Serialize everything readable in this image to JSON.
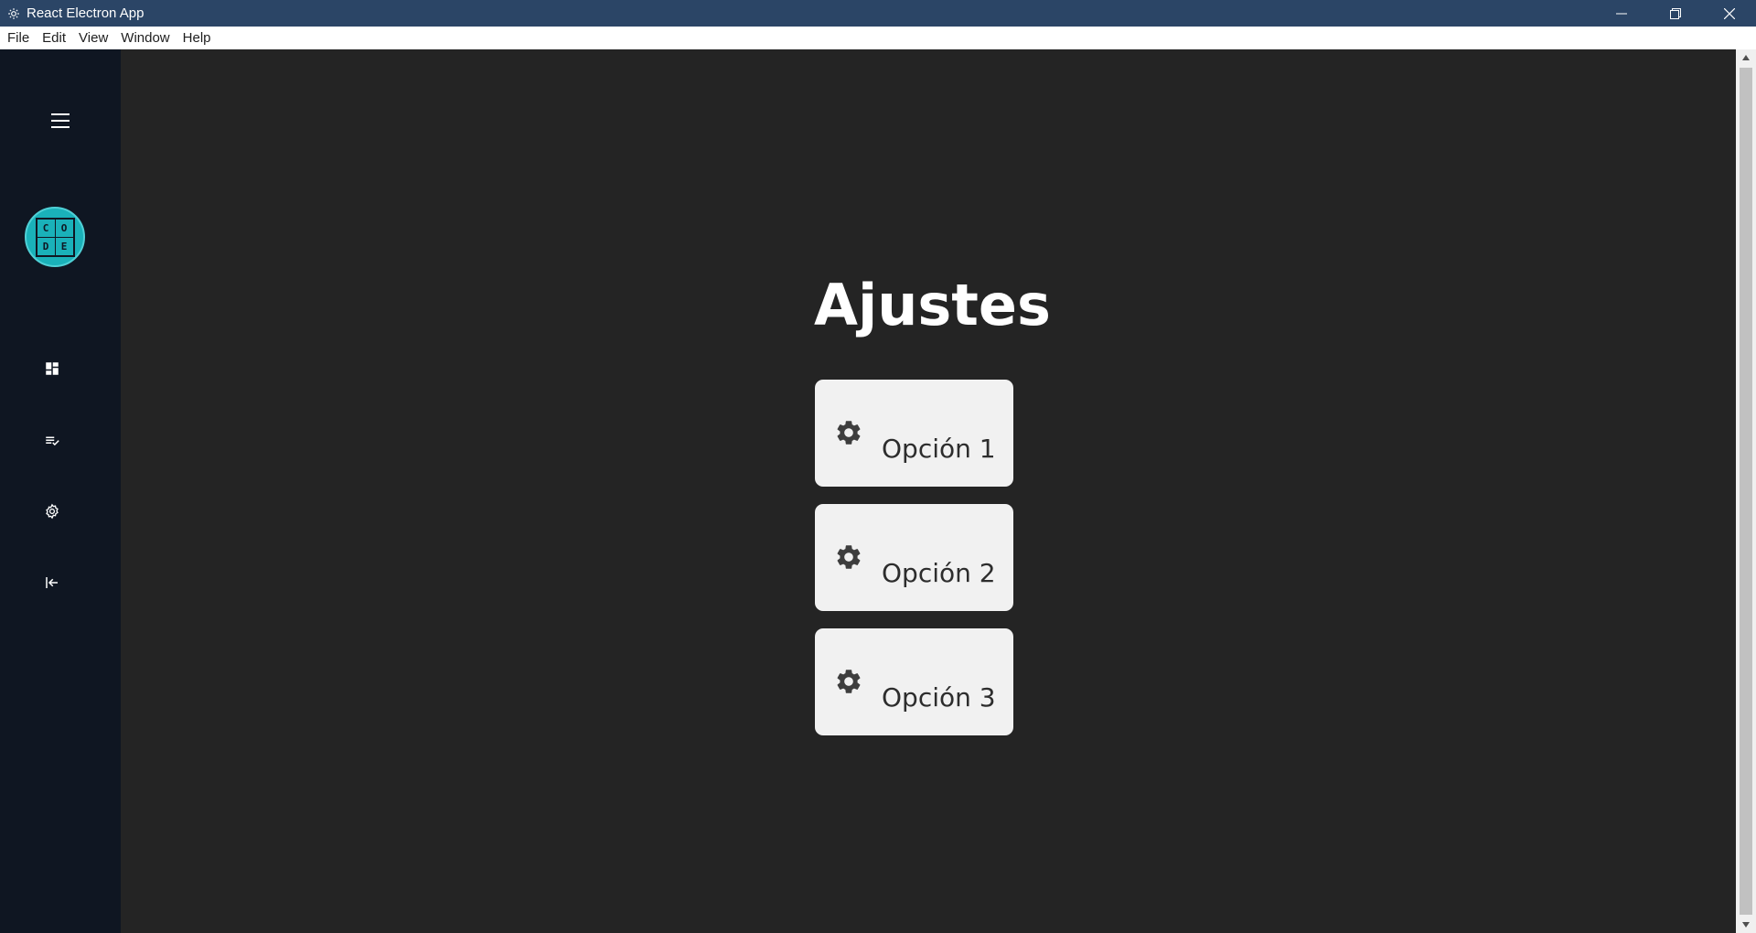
{
  "window": {
    "title": "React Electron App",
    "controls": [
      "minimize-icon",
      "restore-icon",
      "close-icon"
    ]
  },
  "menubar": {
    "items": [
      {
        "label": "File"
      },
      {
        "label": "Edit"
      },
      {
        "label": "View"
      },
      {
        "label": "Window"
      },
      {
        "label": "Help"
      }
    ]
  },
  "sidebar": {
    "menu_icon": "hamburger-menu-icon",
    "avatar": {
      "letters": [
        "C",
        "O",
        "D",
        "E"
      ]
    },
    "items": [
      {
        "icon": "dashboard-icon"
      },
      {
        "icon": "task-list-icon"
      },
      {
        "icon": "settings-icon"
      },
      {
        "icon": "logout-icon"
      }
    ]
  },
  "main": {
    "title": "Ajustes",
    "options": [
      {
        "label": "Opción 1",
        "icon": "gear-icon"
      },
      {
        "label": "Opción 2",
        "icon": "gear-icon"
      },
      {
        "label": "Opción 3",
        "icon": "gear-icon"
      }
    ]
  },
  "colors": {
    "titlebar": "#2b4566",
    "sidebar": "#0f1622",
    "main_bg": "#242424",
    "card_bg": "#f1f1f1",
    "avatar": "#1ab1b9"
  }
}
